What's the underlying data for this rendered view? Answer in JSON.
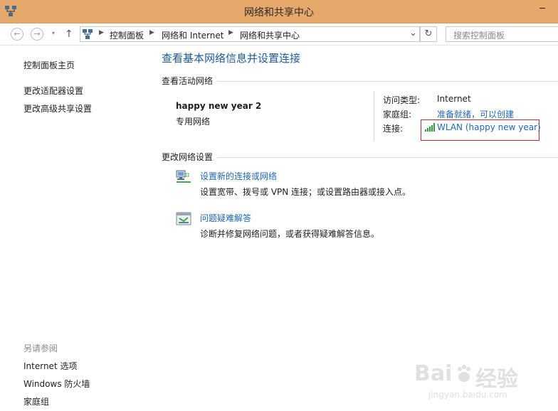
{
  "window": {
    "title": "网络和共享中心",
    "min_glyph": "─",
    "colors": {
      "titlebar": "#e6a96b",
      "link": "#1f68b3",
      "heading": "#1f5a99",
      "highlight": "#d0262d"
    }
  },
  "address": {
    "crumbs": [
      "控制面板",
      "网络和 Internet",
      "网络和共享中心"
    ],
    "dropdown_glyph": "⌄",
    "refresh_glyph": "↻",
    "search_placeholder": "搜索控制面板"
  },
  "nav": {
    "back_glyph": "←",
    "forward_glyph": "→",
    "up_glyph": "↑"
  },
  "sidebar": {
    "home": "控制面板主页",
    "items": [
      "更改适配器设置",
      "更改高级共享设置"
    ],
    "see_also_title": "另请参阅",
    "see_also": [
      "Internet 选项",
      "Windows 防火墙",
      "家庭组"
    ]
  },
  "main": {
    "title": "查看基本网络信息并设置连接",
    "active_networks_title": "查看活动网络",
    "network": {
      "name": "happy new year  2",
      "category": "专用网络",
      "access_type_label": "访问类型:",
      "access_type_value": "Internet",
      "homegroup_label": "家庭组:",
      "homegroup_value": "准备就绪，可以创建",
      "connection_label": "连接:",
      "connection_value": "WLAN (happy new year)"
    },
    "change_settings_title": "更改网络设置",
    "tasks": [
      {
        "title": "设置新的连接或网络",
        "description": "设置宽带、拨号或 VPN 连接；或设置路由器或接入点。",
        "icon": "network-setup-icon"
      },
      {
        "title": "问题疑难解答",
        "description": "诊断并修复网络问题，或者获得疑难解答信息。",
        "icon": "troubleshoot-icon"
      }
    ]
  }
}
